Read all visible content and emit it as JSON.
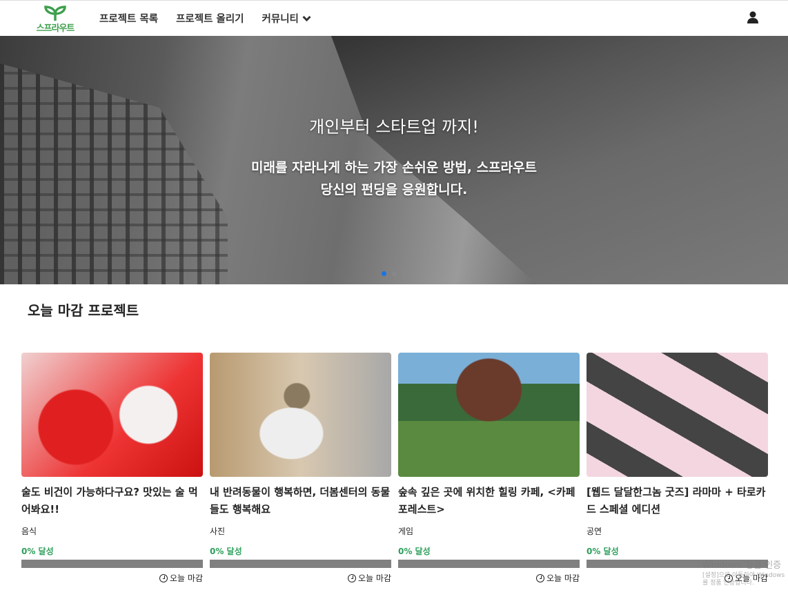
{
  "nav": {
    "logo": "스프라우트",
    "items": [
      "프로젝트 목록",
      "프로젝트 올리기",
      "커뮤니티"
    ]
  },
  "hero": {
    "title": "개인부터 스타트업 까지!",
    "line1": "미래를 자라나게 하는 가장 손쉬운 방법, 스프라우트",
    "line2": "당신의 펀딩을 응원합니다.",
    "slides": 3,
    "active_slide": 1
  },
  "section": {
    "title": "오늘 마감 프로젝트"
  },
  "cards": [
    {
      "title": "술도 비건이 가능하다구요? 맛있는 술 먹어봐요!!",
      "category": "음식",
      "rate": "0% 달성",
      "progress": 0,
      "due": "오늘 마감"
    },
    {
      "title": "내 반려동물이 행복하면, 더봄센터의 동물들도 행복해요",
      "category": "사진",
      "rate": "0% 달성",
      "progress": 0,
      "due": "오늘 마감"
    },
    {
      "title": "숲속 깊은 곳에 위치한 힐링 카페, <카페 포레스트>",
      "category": "게임",
      "rate": "0% 달성",
      "progress": 0,
      "due": "오늘 마감"
    },
    {
      "title": "[웹드 달달한그놈 굿즈] 라마마 + 타로카드 스페셜 에디션",
      "category": "공연",
      "rate": "0% 달성",
      "progress": 0,
      "due": "오늘 마감"
    }
  ],
  "watermark": {
    "line1": "Windows 정품 인증",
    "line2": "[설정]으로 이동하여 Windows를 정품 인증합니다."
  },
  "colors": {
    "brand": "#3fa04e",
    "progress_track": "#808080",
    "rate": "#2e9f5b",
    "dot_active": "#1a73e8"
  }
}
